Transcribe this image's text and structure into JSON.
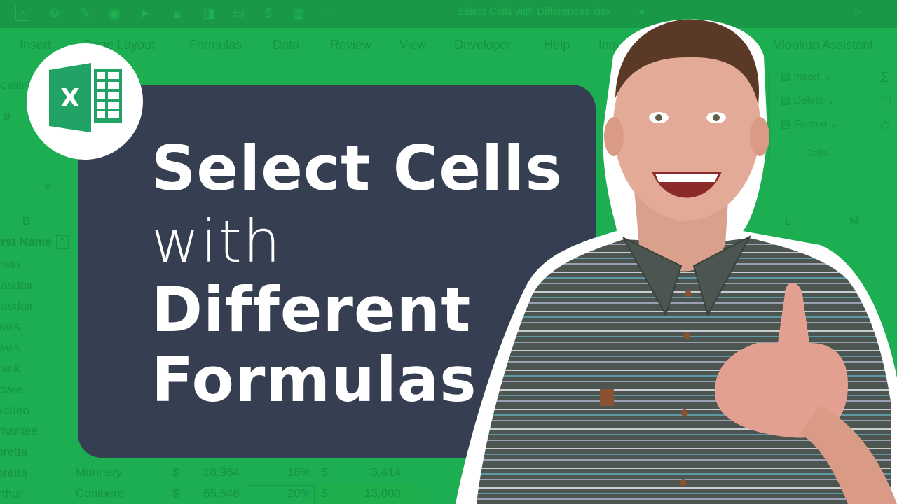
{
  "background_app": {
    "window_title": "Select Cells with Differences.xlsx",
    "title_dropdown": "▾",
    "quick_access_icons": [
      "text-box-icon",
      "gear-icon",
      "brush-icon",
      "insert-image-icon",
      "cursor-icon",
      "lock-icon",
      "freeze-panes-icon",
      "window-icon",
      "dollar-icon",
      "table-icon",
      "customize-chevron-icon"
    ],
    "tabs": [
      "Insert",
      "Page Layout",
      "Formulas",
      "Data",
      "Review",
      "View",
      "Developer",
      "Help",
      "Inquire",
      "Vlookup Assistant"
    ],
    "ribbon": {
      "font_name": "Calibri",
      "bold": "B",
      "cells_group": {
        "insert": "Insert",
        "delete": "Delete",
        "format": "Format",
        "label": "Cells"
      }
    },
    "formula_bar": {
      "cancel": "✕"
    },
    "column_headers": [
      "B",
      "L",
      "M"
    ],
    "table_header": "First Name",
    "first_names": [
      "Erwin",
      "Alasdair",
      "Alasdair",
      "Davis",
      "Davis",
      "Frank",
      "Bowie",
      "Taddeo",
      "Amantee",
      "Loretta",
      "Loretta",
      "Arthur"
    ],
    "visible_rows": [
      {
        "last_name": "Munnery",
        "currency1": "$",
        "amount": "18,964",
        "pct": "18%",
        "currency2": "$",
        "bonus": "3,414"
      },
      {
        "last_name": "Conibere",
        "currency1": "$",
        "amount": "65,546",
        "pct": "20%",
        "currency2": "$",
        "bonus": "13,000"
      }
    ]
  },
  "logo": {
    "letter": "X",
    "app": "Excel"
  },
  "title": {
    "line1": "Select Cells",
    "line2": "with",
    "line3": "Different",
    "line4": "Formulas"
  },
  "colors": {
    "background_green": "#1dae52",
    "panel": "#363f51",
    "excel_green": "#21a366",
    "title_text": "#ffffff"
  }
}
